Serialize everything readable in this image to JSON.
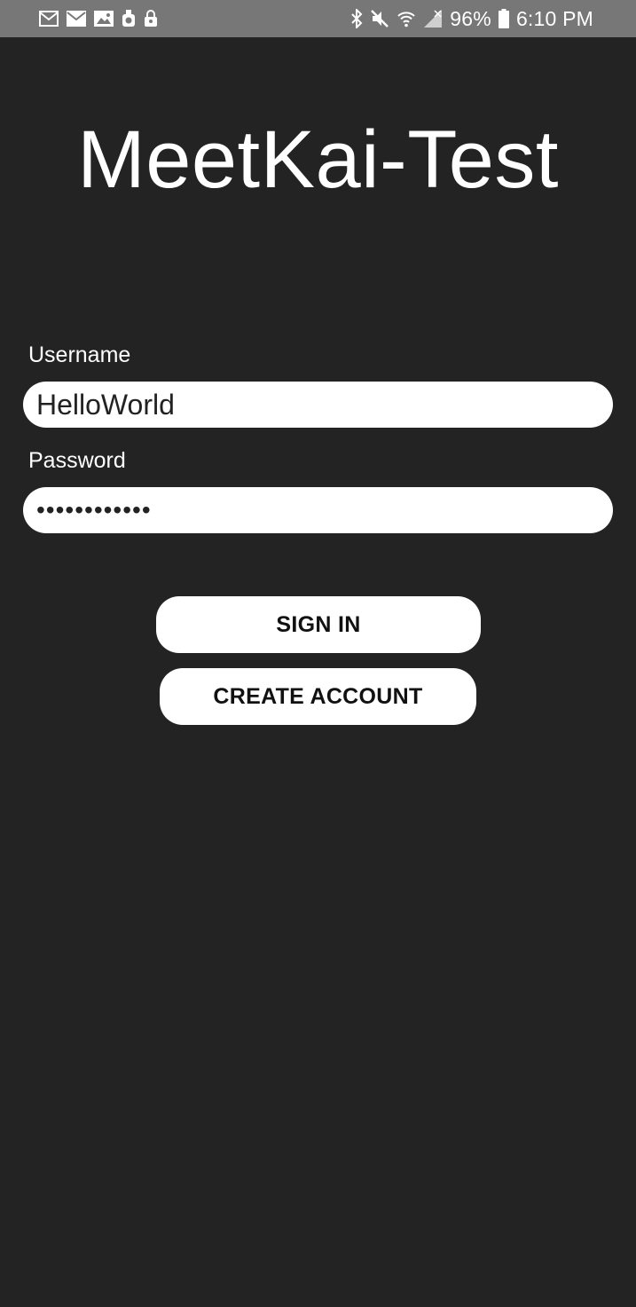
{
  "status_bar": {
    "left_icons": [
      "mail-icon",
      "mail-filled-icon",
      "image-icon",
      "shield-icon",
      "lock-icon"
    ],
    "right_icons": [
      "bluetooth-icon",
      "mute-icon",
      "wifi-icon",
      "signal-icon",
      "battery-icon"
    ],
    "battery_percent": "96%",
    "time": "6:10 PM"
  },
  "app": {
    "title": "MeetKai-Test"
  },
  "form": {
    "username_label": "Username",
    "username_value": "HelloWorld",
    "password_label": "Password",
    "password_value": "••••••••••••",
    "signin_label": "SIGN IN",
    "create_account_label": "CREATE ACCOUNT"
  },
  "colors": {
    "background": "#232323",
    "status_bar": "#777777",
    "field": "#ffffff",
    "text_light": "#ffffff",
    "text_dark": "#111111"
  }
}
